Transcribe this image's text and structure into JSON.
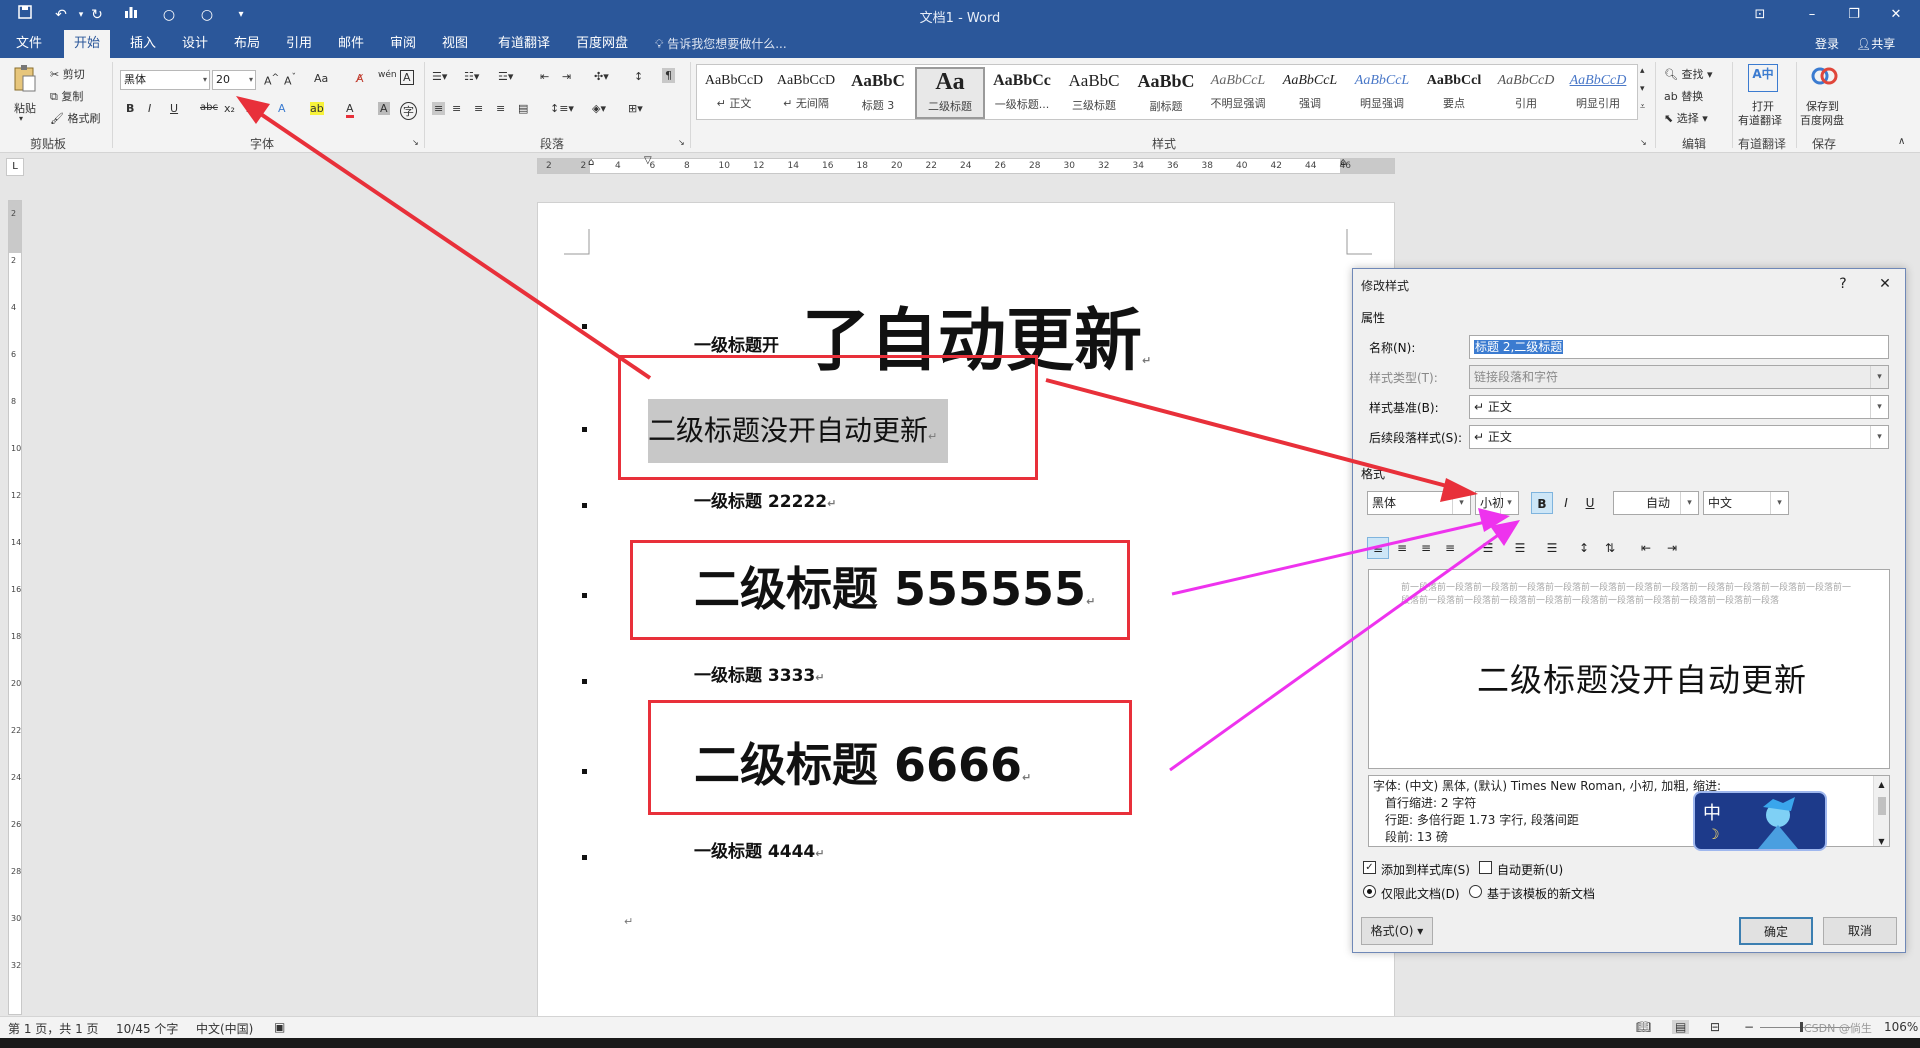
{
  "window": {
    "title": "文档1 - Word"
  },
  "quick_access": {
    "save_icon": "save-icon",
    "undo_icon": "undo-icon",
    "redo_icon": "redo-icon"
  },
  "tabs": [
    {
      "label": "文件"
    },
    {
      "label": "开始",
      "active": true
    },
    {
      "label": "插入"
    },
    {
      "label": "设计"
    },
    {
      "label": "布局"
    },
    {
      "label": "引用"
    },
    {
      "label": "邮件"
    },
    {
      "label": "审阅"
    },
    {
      "label": "视图"
    },
    {
      "label": "有道翻译"
    },
    {
      "label": "百度网盘"
    }
  ],
  "tell_me": "告诉我您想要做什么...",
  "account": {
    "login": "登录",
    "share": "共享"
  },
  "ribbon": {
    "clipboard": {
      "paste": "粘贴",
      "cut": "剪切",
      "copy": "复制",
      "format_painter": "格式刷",
      "label": "剪贴板"
    },
    "font": {
      "name": "黑体",
      "size": "20",
      "label": "字体",
      "case_btn": "Aa",
      "bold": "B",
      "italic": "I",
      "underline": "U",
      "strike": "abc",
      "sub": "x₂",
      "sup": "x²"
    },
    "paragraph": {
      "label": "段落"
    },
    "styles": {
      "label": "样式",
      "items": [
        {
          "sample": "AaBbCcD",
          "name": "↵ 正文"
        },
        {
          "sample": "AaBbCcD",
          "name": "↵ 无间隔"
        },
        {
          "sample": "AaBbC",
          "name": "标题 3"
        },
        {
          "sample": "Aa",
          "name": "二级标题",
          "selected": true
        },
        {
          "sample": "AaBbCc",
          "name": "一级标题..."
        },
        {
          "sample": "AaBbC",
          "name": "三级标题"
        },
        {
          "sample": "AaBbC",
          "name": "副标题"
        },
        {
          "sample": "AaBbCcL",
          "name": "不明显强调"
        },
        {
          "sample": "AaBbCcL",
          "name": "强调"
        },
        {
          "sample": "AaBbCcL",
          "name": "明显强调"
        },
        {
          "sample": "AaBbCcl",
          "name": "要点"
        },
        {
          "sample": "AaBbCcD",
          "name": "引用"
        },
        {
          "sample": "AaBbCcD",
          "name": "明显引用"
        }
      ]
    },
    "editing": {
      "find": "查找",
      "replace": "替换",
      "select": "选择",
      "label": "编辑"
    },
    "youdao": {
      "open": "打开",
      "translate": "有道翻译",
      "label": "有道翻译"
    },
    "baidu": {
      "save_to": "保存到",
      "netdisk": "百度网盘",
      "label": "保存"
    }
  },
  "ruler": {
    "h_ticks": [
      "2",
      "2",
      "4",
      "6",
      "8",
      "10",
      "12",
      "14",
      "16",
      "18",
      "20",
      "22",
      "24",
      "26",
      "28",
      "30",
      "32",
      "34",
      "36",
      "38",
      "40",
      "42",
      "44",
      "46"
    ],
    "v_ticks": [
      "2",
      "2",
      "4",
      "6",
      "8",
      "10",
      "12",
      "14",
      "16",
      "18",
      "20",
      "22",
      "24",
      "26",
      "28",
      "30",
      "32"
    ]
  },
  "document": {
    "lines": [
      {
        "prefix": "一级标题开",
        "big": "了自动更新"
      },
      {
        "text": "二级标题没开自动更新"
      },
      {
        "text": "一级标题 22222"
      },
      {
        "text": "二级标题 555555"
      },
      {
        "text": "一级标题 3333"
      },
      {
        "text": "二级标题 6666"
      },
      {
        "text": "一级标题 4444"
      }
    ],
    "para_mark": "↵"
  },
  "dialog": {
    "title": "修改样式",
    "help": "?",
    "close": "✕",
    "section_props": "属性",
    "name_label": "名称(N):",
    "name_value": "标题 2,二级标题",
    "type_label": "样式类型(T):",
    "type_value": "链接段落和字符",
    "based_label": "样式基准(B):",
    "based_value": "↵ 正文",
    "next_label": "后续段落样式(S):",
    "next_value": "↵ 正文",
    "section_format": "格式",
    "font": "黑体",
    "size": "小初",
    "bold": "B",
    "italic": "I",
    "underline": "U",
    "color": "自动",
    "script": "中文",
    "preview_prev": "前一段落前一段落前一段落前一段落前一段落前一段落前一段落前一段落前一段落前一段落前一段落前一段落前一段落前一段落前一段落前一段落前一段落前一段落前一段落前一段落前一段落前一段落前一段落",
    "preview_text": "二级标题没开自动更新",
    "desc_lines": [
      "字体: (中文) 黑体, (默认) Times New Roman, 小初, 加粗, 缩进:",
      "首行缩进:  2 字符",
      "行距: 多倍行距 1.73 字行, 段落间距",
      "段前: 13 磅"
    ],
    "add_to_gallery": "添加到样式库(S)",
    "auto_update": "自动更新(U)",
    "only_this_doc": "仅限此文档(D)",
    "new_docs": "基于该模板的新文档",
    "format_btn": "格式(O) ▾",
    "ok": "确定",
    "cancel": "取消",
    "ime_char": "中"
  },
  "status": {
    "page": "第 1 页，共 1 页",
    "words": "10/45 个字",
    "lang": "中文(中国)",
    "zoom": "106%",
    "watermark": "CSDN @倘生"
  },
  "colors": {
    "word_blue": "#2b579a",
    "red_arrow": "#e8303a",
    "magenta_arrow": "#ee33ee"
  }
}
